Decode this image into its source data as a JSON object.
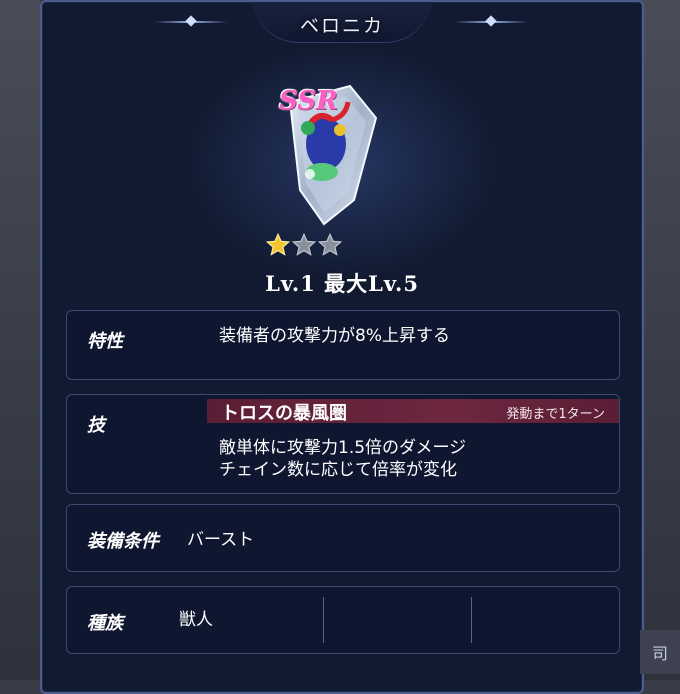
{
  "window": {
    "title": "ベロニカ"
  },
  "item": {
    "rarity": "SSR",
    "stars_filled": 1,
    "stars_total": 3,
    "level_text": "Lv.1 最大Lv.5"
  },
  "trait": {
    "label": "特性",
    "text": "装備者の攻撃力が8%上昇する"
  },
  "skill": {
    "label": "技",
    "name": "トロスの暴風圏",
    "turns": "発動まで1ターン",
    "desc_line1": "敵単体に攻撃力1.5倍のダメージ",
    "desc_line2": "チェイン数に応じて倍率が変化"
  },
  "equip_condition": {
    "label": "装備条件",
    "value": "バースト"
  },
  "race": {
    "label": "種族",
    "value": "獣人",
    "value2": "",
    "value3": ""
  },
  "side_tab": {
    "label": "司"
  },
  "colors": {
    "panel_bg": "#111a30",
    "border": "#4b5d8e",
    "ssr_pink": "#ff5fc4",
    "skill_bar": "#6e2741",
    "star_gold": "#f4c430"
  }
}
